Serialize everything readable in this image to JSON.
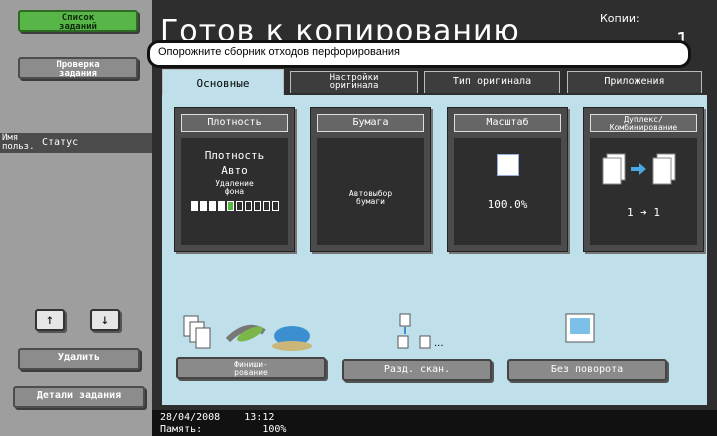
{
  "left_panel": {
    "job_list_btn": "Список\nзаданий",
    "job_check_btn": "Проверка\nзадания",
    "list_header": {
      "user": "Имя\nпольз.",
      "status": "Статус"
    },
    "up_arrow": "↑",
    "down_arrow": "↓",
    "delete_btn": "Удалить",
    "details_btn": "Детали задания"
  },
  "header": {
    "title": "Готов к копированию",
    "copies_label": "Копии:",
    "copies_value": "1"
  },
  "message": "Опорожните сборник отходов перфорирования",
  "tabs": [
    {
      "label": "Основные",
      "active": true
    },
    {
      "label": "Настройки\nоригинала",
      "active": false
    },
    {
      "label": "Тип оригинала",
      "active": false
    },
    {
      "label": "Приложения",
      "active": false
    }
  ],
  "cards": {
    "density": {
      "head": "Плотность",
      "line1": "Плотность",
      "line2": "Авто",
      "line3": "Удаление\nфона"
    },
    "paper": {
      "head": "Бумага",
      "line1": "Автовыбор\nбумаги"
    },
    "zoom": {
      "head": "Масштаб",
      "value": "100.0%"
    },
    "duplex": {
      "head": "Дуплекс/\nКомбинирование",
      "value": "1 ➔ 1"
    }
  },
  "bottom_buttons": {
    "finishing": "Финиши-\nрование",
    "sep_scan": "Разд. скан.",
    "no_rotate": "Без поворота"
  },
  "status_bar": {
    "datetime": "28/04/2008    13:12",
    "second_line": "Память:          100%"
  },
  "colors": {
    "accent_green": "#58b648",
    "content_bg": "#bfe0ea"
  }
}
